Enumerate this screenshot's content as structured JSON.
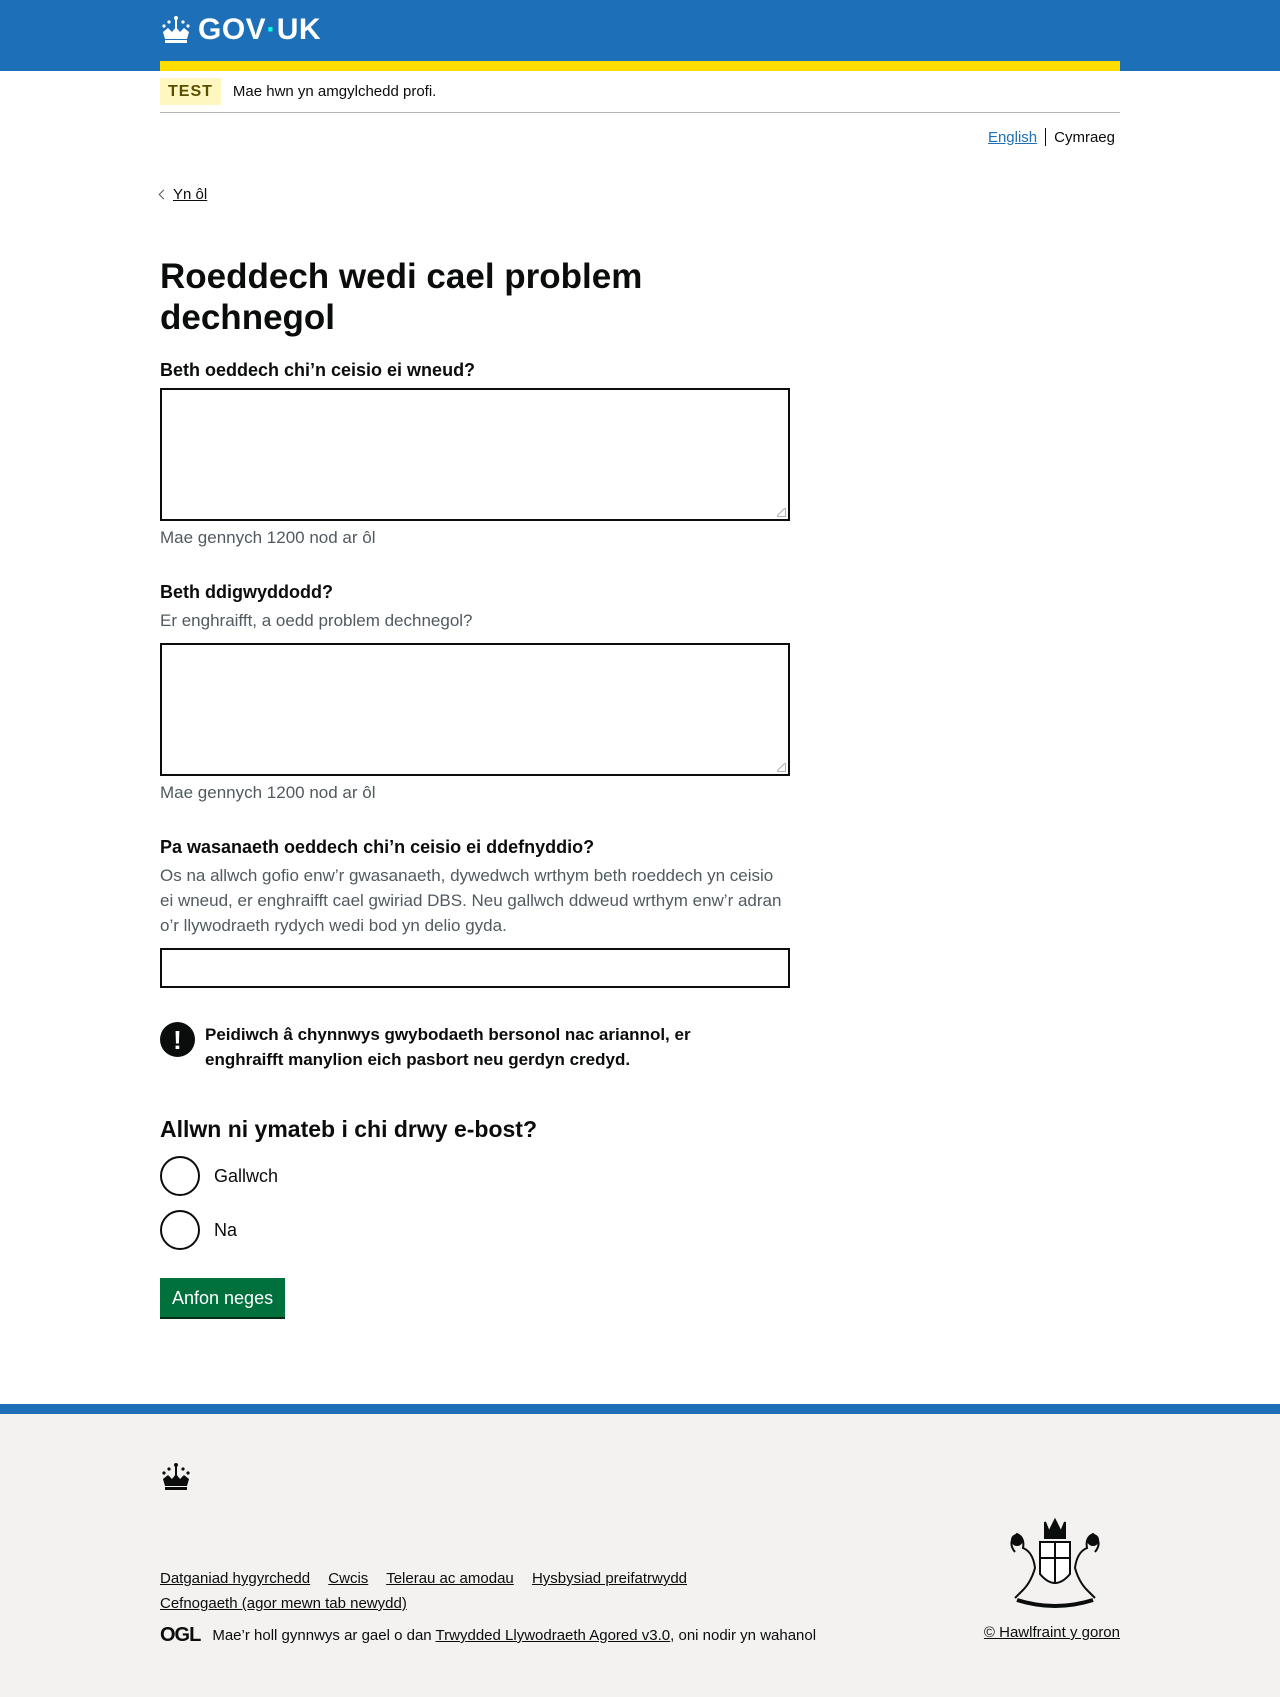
{
  "header": {
    "logo_text_1": "GOV",
    "logo_dot": "·",
    "logo_text_2": "UK"
  },
  "phase": {
    "tag": "TEST",
    "text": "Mae hwn yn amgylchedd profi."
  },
  "language": {
    "english": "English",
    "cymraeg": "Cymraeg"
  },
  "back_link": "Yn ôl",
  "page_title": "Roeddech wedi cael problem dechnegol",
  "form": {
    "q1_label": "Beth oeddech chi’n ceisio ei wneud?",
    "q1_counter": "Mae gennych 1200 nod ar ôl",
    "q2_label": "Beth ddigwyddodd?",
    "q2_hint": "Er enghraifft, a oedd problem dechnegol?",
    "q2_counter": "Mae gennych 1200 nod ar ôl",
    "q3_label": "Pa wasanaeth oeddech chi’n ceisio ei ddefnyddio?",
    "q3_hint": "Os na allwch gofio enw’r gwasanaeth, dywedwch wrthym beth roeddech yn ceisio ei wneud, er enghraifft cael gwiriad DBS. Neu gallwch ddweud wrthym enw’r adran o’r llywodraeth rydych wedi bod yn delio gyda.",
    "warning_icon": "!",
    "warning_text": "Peidiwch â chynnwys gwybodaeth bersonol nac ariannol, er enghraifft manylion eich pasbort neu gerdyn credyd.",
    "email_question": "Allwn ni ymateb i chi drwy e-bost?",
    "radio_yes": "Gallwch",
    "radio_no": "Na",
    "submit": "Anfon neges"
  },
  "footer": {
    "links": [
      "Datganiad hygyrchedd",
      "Cwcis",
      "Telerau ac amodau",
      "Hysbysiad preifatrwydd",
      "Cefnogaeth (agor mewn tab newydd)"
    ],
    "ogl_logo": "OGL",
    "licence_prefix": "Mae’r holl gynnwys ar gael o dan",
    "licence_link": "Trwydded Llywodraeth Agored v3.0",
    "licence_suffix": ", oni nodir yn wahanol",
    "copyright": "© Hawlfraint y goron"
  },
  "colors": {
    "header_blue": "#1d70b8",
    "stripe_yellow": "#ffdd00",
    "button_green": "#00703c",
    "footer_bg": "#f3f2f1"
  }
}
